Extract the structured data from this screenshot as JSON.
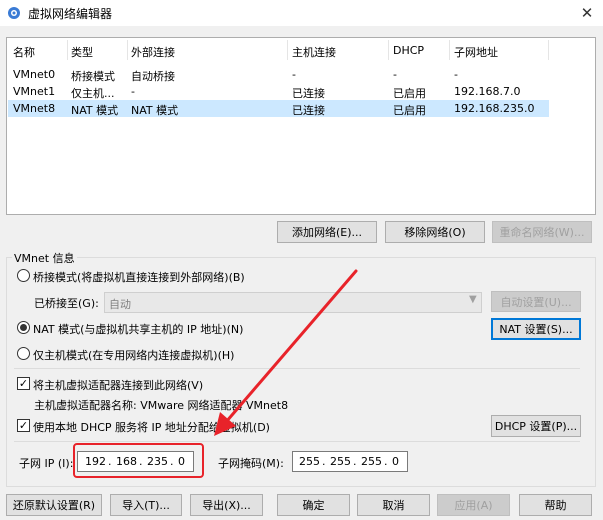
{
  "window": {
    "title": "虚拟网络编辑器",
    "close_glyph": "✕"
  },
  "columns": [
    "名称",
    "类型",
    "外部连接",
    "主机连接",
    "DHCP",
    "子网地址"
  ],
  "rows": [
    [
      "VMnet0",
      "桥接模式",
      "自动桥接",
      "-",
      "-",
      "-"
    ],
    [
      "VMnet1",
      "仅主机...",
      "-",
      "已连接",
      "已启用",
      "192.168.7.0"
    ],
    [
      "VMnet8",
      "NAT 模式",
      "NAT 模式",
      "已连接",
      "已启用",
      "192.168.235.0"
    ]
  ],
  "selected_row": 2,
  "list_buttons": {
    "add": "添加网络(E)...",
    "remove": "移除网络(O)",
    "rename": "重命名网络(W)..."
  },
  "vmnet_info": {
    "label": "VMnet 信息",
    "bridged": "桥接模式(将虚拟机直接连接到外部网络)(B)",
    "bridged_to_label": "已桥接至(G):",
    "bridged_to_value": "自动",
    "auto_settings": "自动设置(U)...",
    "nat": "NAT 模式(与虚拟机共享主机的 IP 地址)(N)",
    "nat_settings": "NAT 设置(S)...",
    "host_only": "仅主机模式(在专用网络内连接虚拟机)(H)",
    "connect_adapter": "将主机虚拟适配器连接到此网络(V)",
    "adapter_name": "主机虚拟适配器名称: VMware 网络适配器 VMnet8",
    "use_dhcp": "使用本地 DHCP 服务将 IP 地址分配给虚拟机(D)",
    "dhcp_settings": "DHCP 设置(P)...",
    "subnet_ip_label": "子网 IP (I):",
    "subnet_ip": [
      "192",
      "168",
      "235",
      "0"
    ],
    "subnet_mask_label": "子网掩码(M):",
    "subnet_mask": [
      "255",
      "255",
      "255",
      "0"
    ]
  },
  "footer": {
    "restore": "还原默认设置(R)",
    "import": "导入(T)...",
    "export": "导出(X)...",
    "ok": "确定",
    "cancel": "取消",
    "apply": "应用(A)",
    "help": "帮助"
  },
  "selected_mode": "nat",
  "connect_adapter_checked": true,
  "use_dhcp_checked": true,
  "colors": {
    "selection": "#cce8ff",
    "annotation": "#e8232a",
    "accent": "#0078d7"
  }
}
